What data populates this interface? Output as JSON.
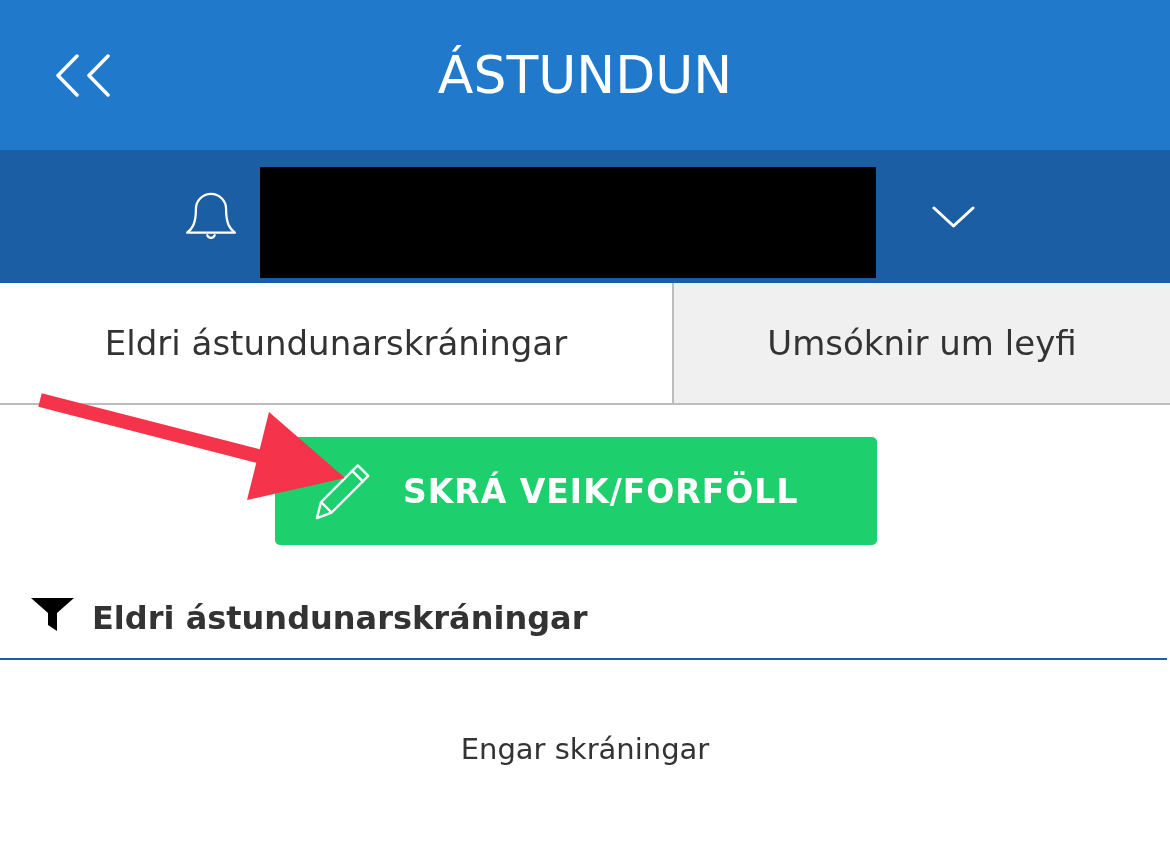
{
  "header": {
    "title": "ÁSTUNDUN"
  },
  "tabs": [
    {
      "label": "Eldri ástundunarskráningar",
      "selected": true
    },
    {
      "label": "Umsóknir um leyfi",
      "selected": false
    }
  ],
  "action_button": {
    "label": "SKRÁ VEIK/FORFÖLL"
  },
  "section": {
    "title": "Eldri ástundunarskráningar",
    "empty_message": "Engar skráningar"
  }
}
